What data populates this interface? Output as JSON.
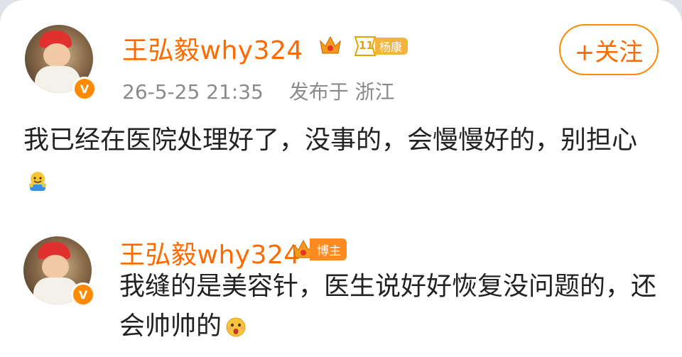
{
  "post": {
    "username": "王弘毅why324",
    "fan_badge": {
      "level": "11",
      "name": "杨康"
    },
    "follow_label": "+关注",
    "time": "26-5-25 21:35",
    "location": "发布于 浙江",
    "text": "我已经在医院处理好了，没事的，会慢慢好的，别担心",
    "emoji": "hug-emoji"
  },
  "reply": {
    "username": "王弘毅why324",
    "role_badge": "博主",
    "text": "我缝的是美容针，医生说好好恢复没问题的，还会帅帅的",
    "emoji": "surprised-face-emoji"
  },
  "colors": {
    "accent": "#ff6a00",
    "follow_border": "#ff8a00",
    "meta_gray": "#8a8a8a",
    "verified": "#ff8a00"
  }
}
